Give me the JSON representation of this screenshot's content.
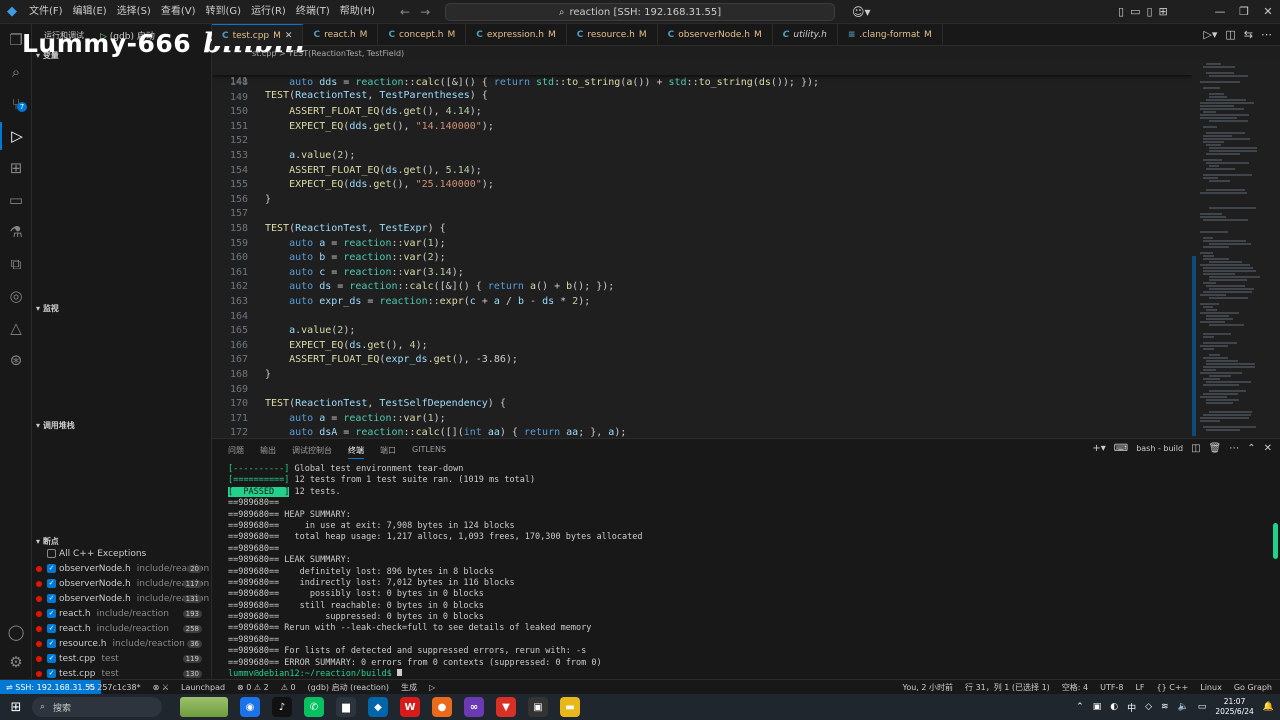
{
  "titlebar": {
    "menus": [
      "文件(F)",
      "编辑(E)",
      "选择(S)",
      "查看(V)",
      "转到(G)",
      "运行(R)",
      "终端(T)",
      "帮助(H)"
    ],
    "search_text": "reaction [SSH: 192.168.31.55]"
  },
  "watermark": {
    "text": "Lummy-666",
    "brand": "bilibili"
  },
  "sidebar": {
    "run_header": "运行和调试",
    "debug_config": "(gdb) 启动",
    "sections": {
      "explorer": "变量",
      "watch": "监视",
      "callstack": "调用堆栈",
      "breakpoints": "断点"
    },
    "breakpoints": [
      {
        "file": "All C++ Exceptions",
        "path": "",
        "count": "",
        "checked": false,
        "dot": false
      },
      {
        "file": "observerNode.h",
        "path": "include/reaction",
        "count": "20",
        "checked": true,
        "dot": true
      },
      {
        "file": "observerNode.h",
        "path": "include/reaction",
        "count": "117",
        "checked": true,
        "dot": true
      },
      {
        "file": "observerNode.h",
        "path": "include/reaction",
        "count": "131",
        "checked": true,
        "dot": true
      },
      {
        "file": "react.h",
        "path": "include/reaction",
        "count": "193",
        "checked": true,
        "dot": true
      },
      {
        "file": "react.h",
        "path": "include/reaction",
        "count": "258",
        "checked": true,
        "dot": true
      },
      {
        "file": "resource.h",
        "path": "include/reaction",
        "count": "36",
        "checked": true,
        "dot": true
      },
      {
        "file": "test.cpp",
        "path": "test",
        "count": "119",
        "checked": true,
        "dot": true
      },
      {
        "file": "test.cpp",
        "path": "test",
        "count": "130",
        "checked": true,
        "dot": true
      }
    ]
  },
  "tabs": [
    {
      "name": "test.cpp",
      "state": "M",
      "active": true
    },
    {
      "name": "react.h",
      "state": "M",
      "active": false
    },
    {
      "name": "concept.h",
      "state": "M",
      "active": false
    },
    {
      "name": "expression.h",
      "state": "M",
      "active": false
    },
    {
      "name": "resource.h",
      "state": "M",
      "active": false
    },
    {
      "name": "observerNode.h",
      "state": "M",
      "active": false
    },
    {
      "name": "utility.h",
      "state": "",
      "active": false
    },
    {
      "name": ".clang-format",
      "state": "M",
      "active": false
    }
  ],
  "breadcrumb": "st.cpp  >  TEST(ReactionTest, TestField)",
  "editor": {
    "sticky_line": "141",
    "sticky_code": "TEST(ReactionTest, TestParentheses) {",
    "lines": [
      {
        "n": "148",
        "code": "    auto dds = reaction::calc([&]() { return std::to_string(a()) + std::to_string(ds()); });"
      },
      {
        "n": "149",
        "code": ""
      },
      {
        "n": "150",
        "code": "    ASSERT_FLOAT_EQ(ds.get(), 4.14);"
      },
      {
        "n": "151",
        "code": "    EXPECT_EQ(dds.get(), \"14.140000\");"
      },
      {
        "n": "152",
        "code": ""
      },
      {
        "n": "153",
        "code": "    a.value(2);"
      },
      {
        "n": "154",
        "code": "    ASSERT_FLOAT_EQ(ds.get(), 5.14);"
      },
      {
        "n": "155",
        "code": "    EXPECT_EQ(dds.get(), \"25.140000\");"
      },
      {
        "n": "156",
        "code": "}"
      },
      {
        "n": "157",
        "code": ""
      },
      {
        "n": "158",
        "code": "TEST(ReactionTest, TestExpr) {"
      },
      {
        "n": "159",
        "code": "    auto a = reaction::var(1);"
      },
      {
        "n": "160",
        "code": "    auto b = reaction::var(2);"
      },
      {
        "n": "161",
        "code": "    auto c = reaction::var(3.14);"
      },
      {
        "n": "162",
        "code": "    auto ds = reaction::calc([&]() { return a() + b(); });"
      },
      {
        "n": "163",
        "code": "    auto expr_ds = reaction::expr(c + a / b - ds * 2);"
      },
      {
        "n": "164",
        "code": ""
      },
      {
        "n": "165",
        "code": "    a.value(2);"
      },
      {
        "n": "166",
        "code": "    EXPECT_EQ(ds.get(), 4);"
      },
      {
        "n": "167",
        "code": "    ASSERT_FLOAT_EQ(expr_ds.get(), -3.86);"
      },
      {
        "n": "168",
        "code": "}"
      },
      {
        "n": "169",
        "code": ""
      },
      {
        "n": "170",
        "code": "TEST(ReactionTest, TestSelfDependency) {"
      },
      {
        "n": "171",
        "code": "    auto a = reaction::var(1);"
      },
      {
        "n": "172",
        "code": "    auto dsA = reaction::calc([](int aa) { return aa; }, a);"
      }
    ]
  },
  "panel": {
    "tabs": [
      "问题",
      "输出",
      "调试控制台",
      "终端",
      "端口",
      "GITLENS"
    ],
    "active_tab": "终端",
    "terminal_name": "bash - build",
    "terminal_lines": [
      {
        "pre": "[----------]",
        "text": " Global test environment tear-down"
      },
      {
        "pre": "[==========]",
        "text": " 12 tests from 1 test suite ran. (1019 ms total)"
      },
      {
        "pre": "[  PASSED  ]",
        "text": " 12 tests."
      },
      {
        "pre": "",
        "text": "==989680=="
      },
      {
        "pre": "",
        "text": "==989680== HEAP SUMMARY:"
      },
      {
        "pre": "",
        "text": "==989680==     in use at exit: 7,908 bytes in 124 blocks"
      },
      {
        "pre": "",
        "text": "==989680==   total heap usage: 1,217 allocs, 1,093 frees, 170,300 bytes allocated"
      },
      {
        "pre": "",
        "text": "==989680=="
      },
      {
        "pre": "",
        "text": "==989680== LEAK SUMMARY:"
      },
      {
        "pre": "",
        "text": "==989680==    definitely lost: 896 bytes in 8 blocks"
      },
      {
        "pre": "",
        "text": "==989680==    indirectly lost: 7,012 bytes in 116 blocks"
      },
      {
        "pre": "",
        "text": "==989680==      possibly lost: 0 bytes in 0 blocks"
      },
      {
        "pre": "",
        "text": "==989680==    still reachable: 0 bytes in 0 blocks"
      },
      {
        "pre": "",
        "text": "==989680==         suppressed: 0 bytes in 0 blocks"
      },
      {
        "pre": "",
        "text": "==989680== Rerun with --leak-check=full to see details of leaked memory"
      },
      {
        "pre": "",
        "text": "==989680=="
      },
      {
        "pre": "",
        "text": "==989680== For lists of detected and suppressed errors, rerun with: -s"
      },
      {
        "pre": "",
        "text": "==989680== ERROR SUMMARY: 0 errors from 0 contexts (suppressed: 0 from 0)"
      }
    ],
    "prompt": "lummy@debian12:~/reaction/build$ "
  },
  "statusbar": {
    "remote": "SSH: 192.168.31.55",
    "left": [
      "↻ 257c1c38*",
      "⊗ ⚔",
      "Launchpad",
      "⊗ 0 ⚠ 2",
      "⚠ 0",
      "(gdb) 启动 (reaction)",
      "生成",
      "▷"
    ],
    "right": [
      "You, 2 小时前",
      "行 31，列 1 (已选择 1)",
      "空格: 4",
      "UTF-8",
      "LF",
      "{} C++",
      "Linux",
      "Go Graph"
    ]
  },
  "taskbar": {
    "search": "搜索",
    "time": "21:07",
    "date": "2025/6/24"
  }
}
